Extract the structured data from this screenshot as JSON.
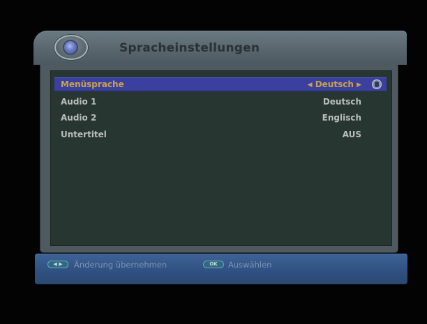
{
  "header": {
    "title": "Spracheinstellungen",
    "icon": "settings-disc-icon"
  },
  "settings": [
    {
      "label": "Menüsprache",
      "value": "Deutsch",
      "selected": true,
      "left_arrow": "◀",
      "right_arrow": "▶",
      "icon": "lock-icon"
    },
    {
      "label": "Audio 1",
      "value": "Deutsch"
    },
    {
      "label": "Audio 2",
      "value": "Englisch"
    },
    {
      "label": "Untertitel",
      "value": "AUS"
    }
  ],
  "footer": {
    "change_button": {
      "key_label": "◀ ▶",
      "text": "Änderung übernehmen"
    },
    "select_button": {
      "key_label": "OK",
      "text": "Auswählen"
    }
  },
  "colors": {
    "background": "#000000",
    "panel": "#283632",
    "frame": "#4f5a60",
    "highlight": "#3b3fa0",
    "highlight_text": "#c6a44a",
    "text": "#b9bdbb",
    "footer": "#2f507f"
  }
}
